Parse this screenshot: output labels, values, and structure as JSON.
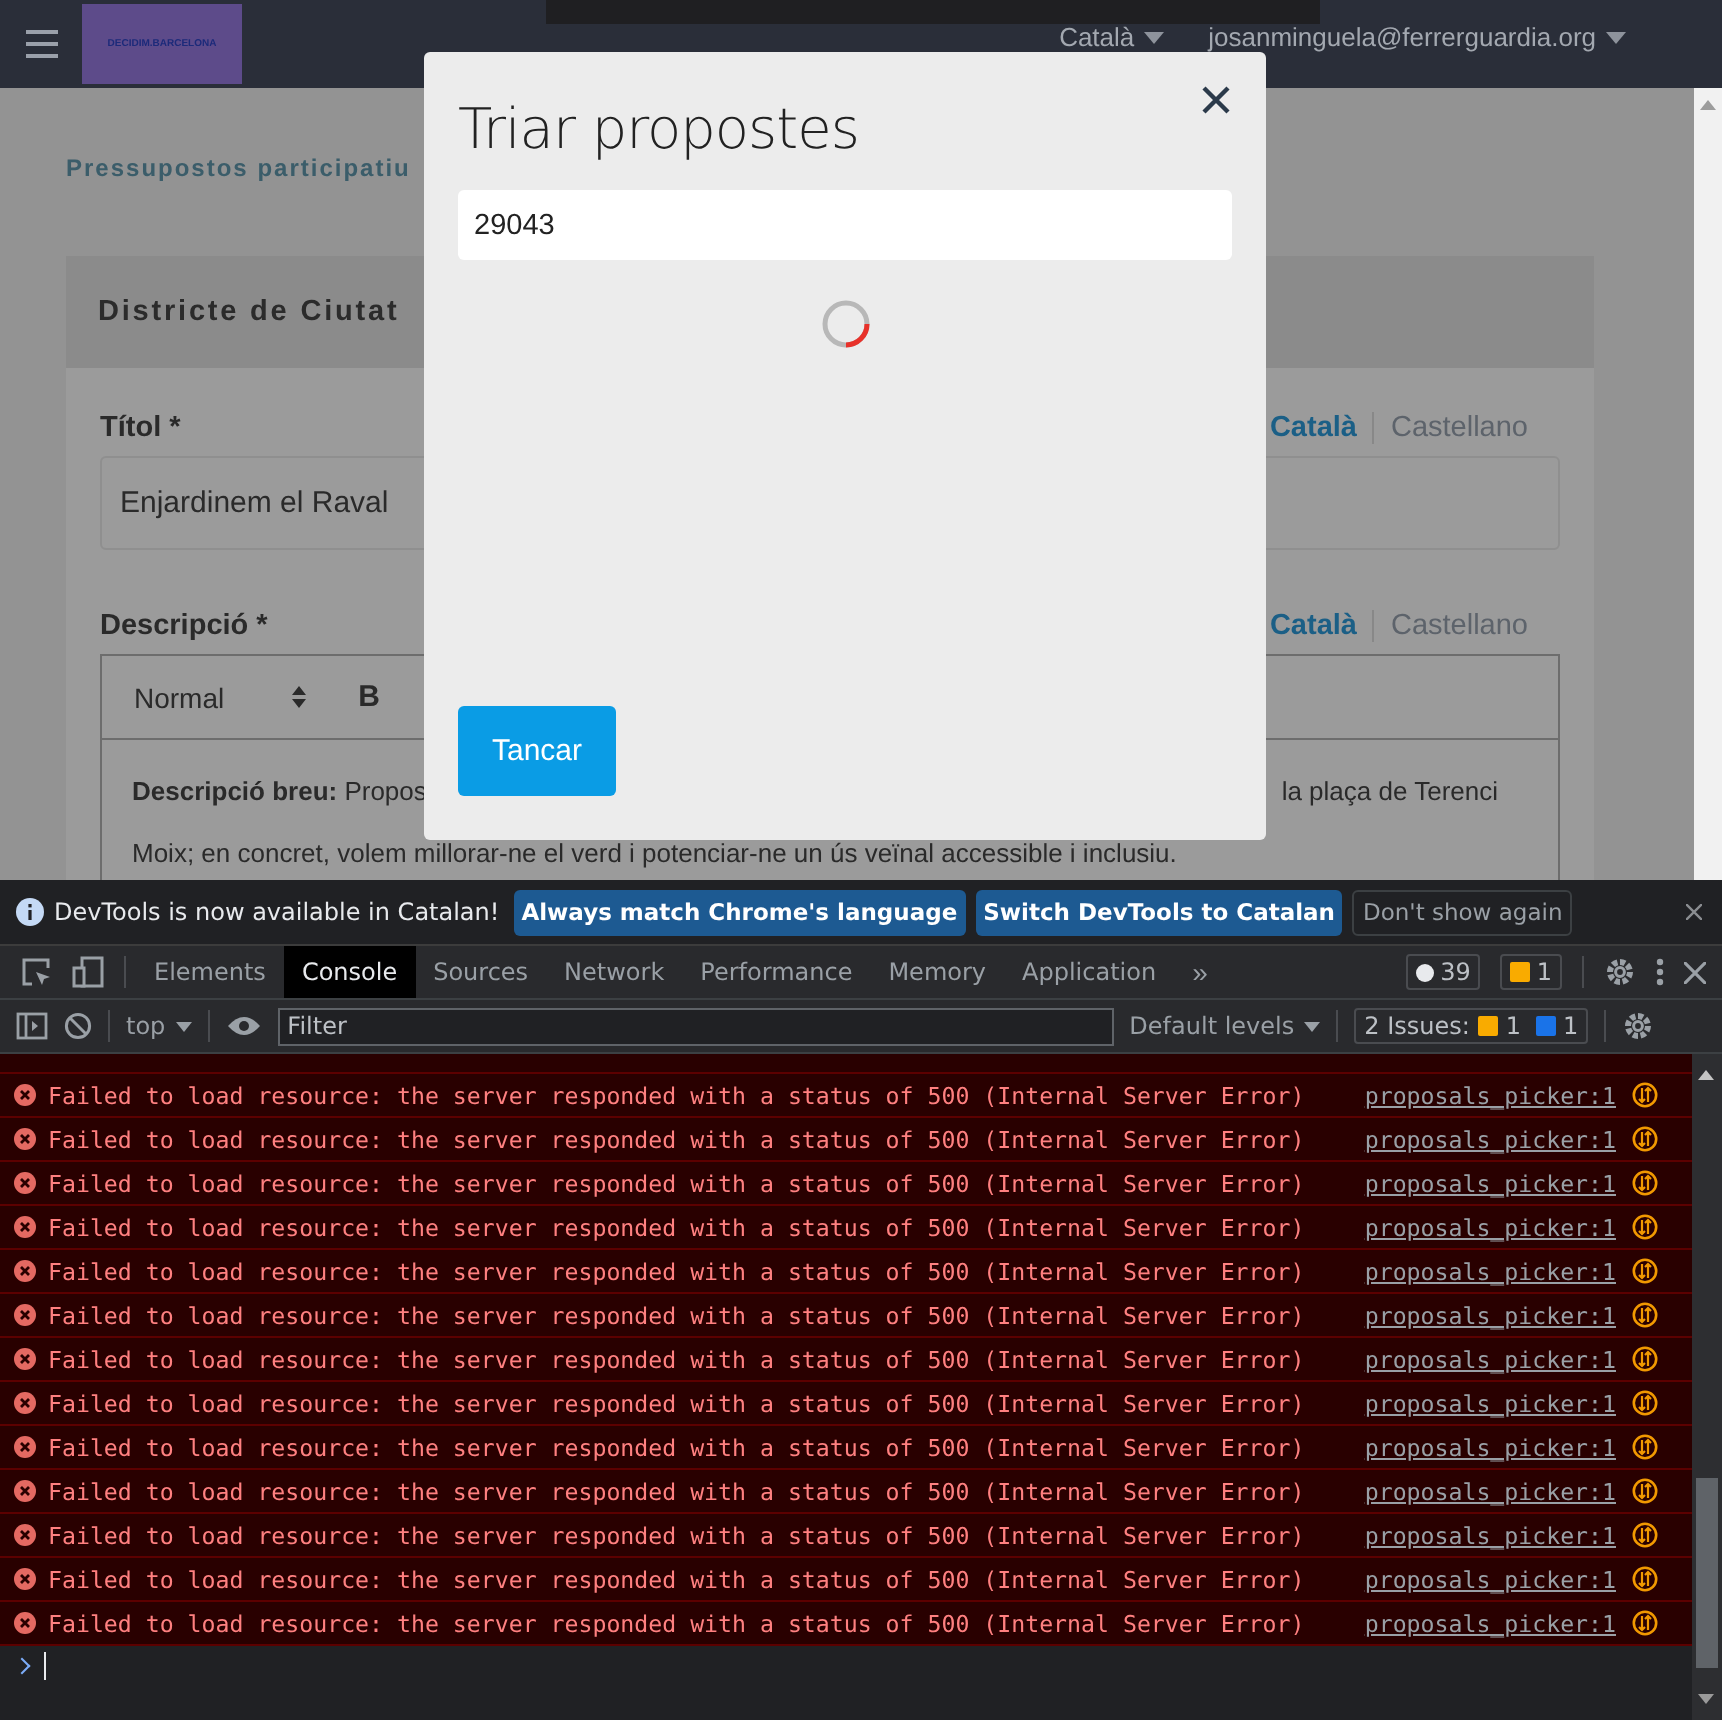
{
  "header": {
    "logo": "DECIDIM.BARCELONA",
    "language": "Català",
    "user": "josanminguela@ferrerguardia.org"
  },
  "page": {
    "breadcrumb": "Pressupostos participatiu",
    "card_title": "Districte de Ciutat",
    "fields": [
      {
        "kind": "input",
        "label": "Títol *",
        "languages": [
          {
            "label": "Català",
            "selected": true
          },
          {
            "label": "Castellano",
            "selected": false
          }
        ],
        "value": "Enjardinem el Raval"
      },
      {
        "kind": "editor",
        "label": "Descripció *",
        "languages": [
          {
            "label": "Català",
            "selected": true
          },
          {
            "label": "Castellano",
            "selected": false
          }
        ],
        "format": "Normal",
        "bold": "B",
        "text_left": "**Descripció breu:** Propos",
        "text_right": "la plaça de Terenci",
        "text_line": "Moix; en concret, volem millorar-ne el verd i potenciar-ne un ús veïnal accessible i inclusiu."
      }
    ]
  },
  "modal": {
    "title": "Triar propostes",
    "search_value": "29043",
    "loading": true,
    "button": "Tancar"
  },
  "devtools": {
    "notice": "DevTools is now available in Catalan!",
    "notice_buttons": [
      {
        "label": "Always match Chrome's language",
        "kind": "primary"
      },
      {
        "label": "Switch DevTools to Catalan",
        "kind": "primary"
      },
      {
        "label": "Don't show again",
        "kind": "outline"
      }
    ],
    "tabs": [
      {
        "label": "Elements",
        "selected": false
      },
      {
        "label": "Console",
        "selected": true
      },
      {
        "label": "Sources",
        "selected": false
      },
      {
        "label": "Network",
        "selected": false
      },
      {
        "label": "Performance",
        "selected": false
      },
      {
        "label": "Memory",
        "selected": false
      },
      {
        "label": "Application",
        "selected": false
      }
    ],
    "more": "»",
    "messages_count": "39",
    "warnings_count": "1",
    "context": "top",
    "filter_placeholder": "Filter",
    "levels": "Default levels",
    "issues": {
      "label": "2 Issues:",
      "warnings": "1",
      "info": "1"
    },
    "messages": [
      {
        "text": "Failed to load resource: the server responded with a status of 500 (Internal Server Error)",
        "source": "proposals_picker:1"
      },
      {
        "text": "Failed to load resource: the server responded with a status of 500 (Internal Server Error)",
        "source": "proposals_picker:1"
      },
      {
        "text": "Failed to load resource: the server responded with a status of 500 (Internal Server Error)",
        "source": "proposals_picker:1"
      },
      {
        "text": "Failed to load resource: the server responded with a status of 500 (Internal Server Error)",
        "source": "proposals_picker:1"
      },
      {
        "text": "Failed to load resource: the server responded with a status of 500 (Internal Server Error)",
        "source": "proposals_picker:1"
      },
      {
        "text": "Failed to load resource: the server responded with a status of 500 (Internal Server Error)",
        "source": "proposals_picker:1"
      },
      {
        "text": "Failed to load resource: the server responded with a status of 500 (Internal Server Error)",
        "source": "proposals_picker:1"
      },
      {
        "text": "Failed to load resource: the server responded with a status of 500 (Internal Server Error)",
        "source": "proposals_picker:1"
      },
      {
        "text": "Failed to load resource: the server responded with a status of 500 (Internal Server Error)",
        "source": "proposals_picker:1"
      },
      {
        "text": "Failed to load resource: the server responded with a status of 500 (Internal Server Error)",
        "source": "proposals_picker:1"
      },
      {
        "text": "Failed to load resource: the server responded with a status of 500 (Internal Server Error)",
        "source": "proposals_picker:1"
      },
      {
        "text": "Failed to load resource: the server responded with a status of 500 (Internal Server Error)",
        "source": "proposals_picker:1"
      },
      {
        "text": "Failed to load resource: the server responded with a status of 500 (Internal Server Error)",
        "source": "proposals_picker:1"
      }
    ]
  }
}
